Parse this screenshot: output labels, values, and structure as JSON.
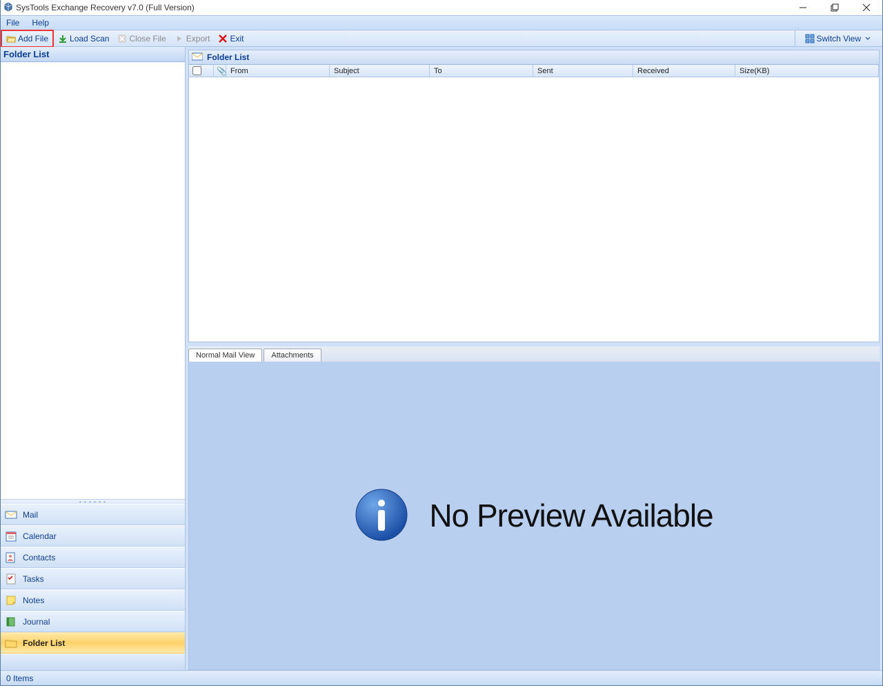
{
  "title": "SysTools Exchange Recovery v7.0 (Full Version)",
  "menu": {
    "file": "File",
    "help": "Help"
  },
  "toolbar": {
    "add_file": "Add File",
    "load_scan": "Load Scan",
    "close_file": "Close File",
    "export": "Export",
    "exit": "Exit",
    "switch_view": "Switch View"
  },
  "left_header": "Folder List",
  "nav": {
    "mail": "Mail",
    "calendar": "Calendar",
    "contacts": "Contacts",
    "tasks": "Tasks",
    "notes": "Notes",
    "journal": "Journal",
    "folder_list": "Folder List"
  },
  "right_header": "Folder List",
  "columns": {
    "from": "From",
    "subject": "Subject",
    "to": "To",
    "sent": "Sent",
    "received": "Received",
    "size": "Size(KB)",
    "attach_glyph": "📎"
  },
  "tabs": {
    "normal": "Normal Mail View",
    "attachments": "Attachments"
  },
  "preview_msg": "No Preview Available",
  "status": "0 Items",
  "grip_dots": "• • • • • •"
}
